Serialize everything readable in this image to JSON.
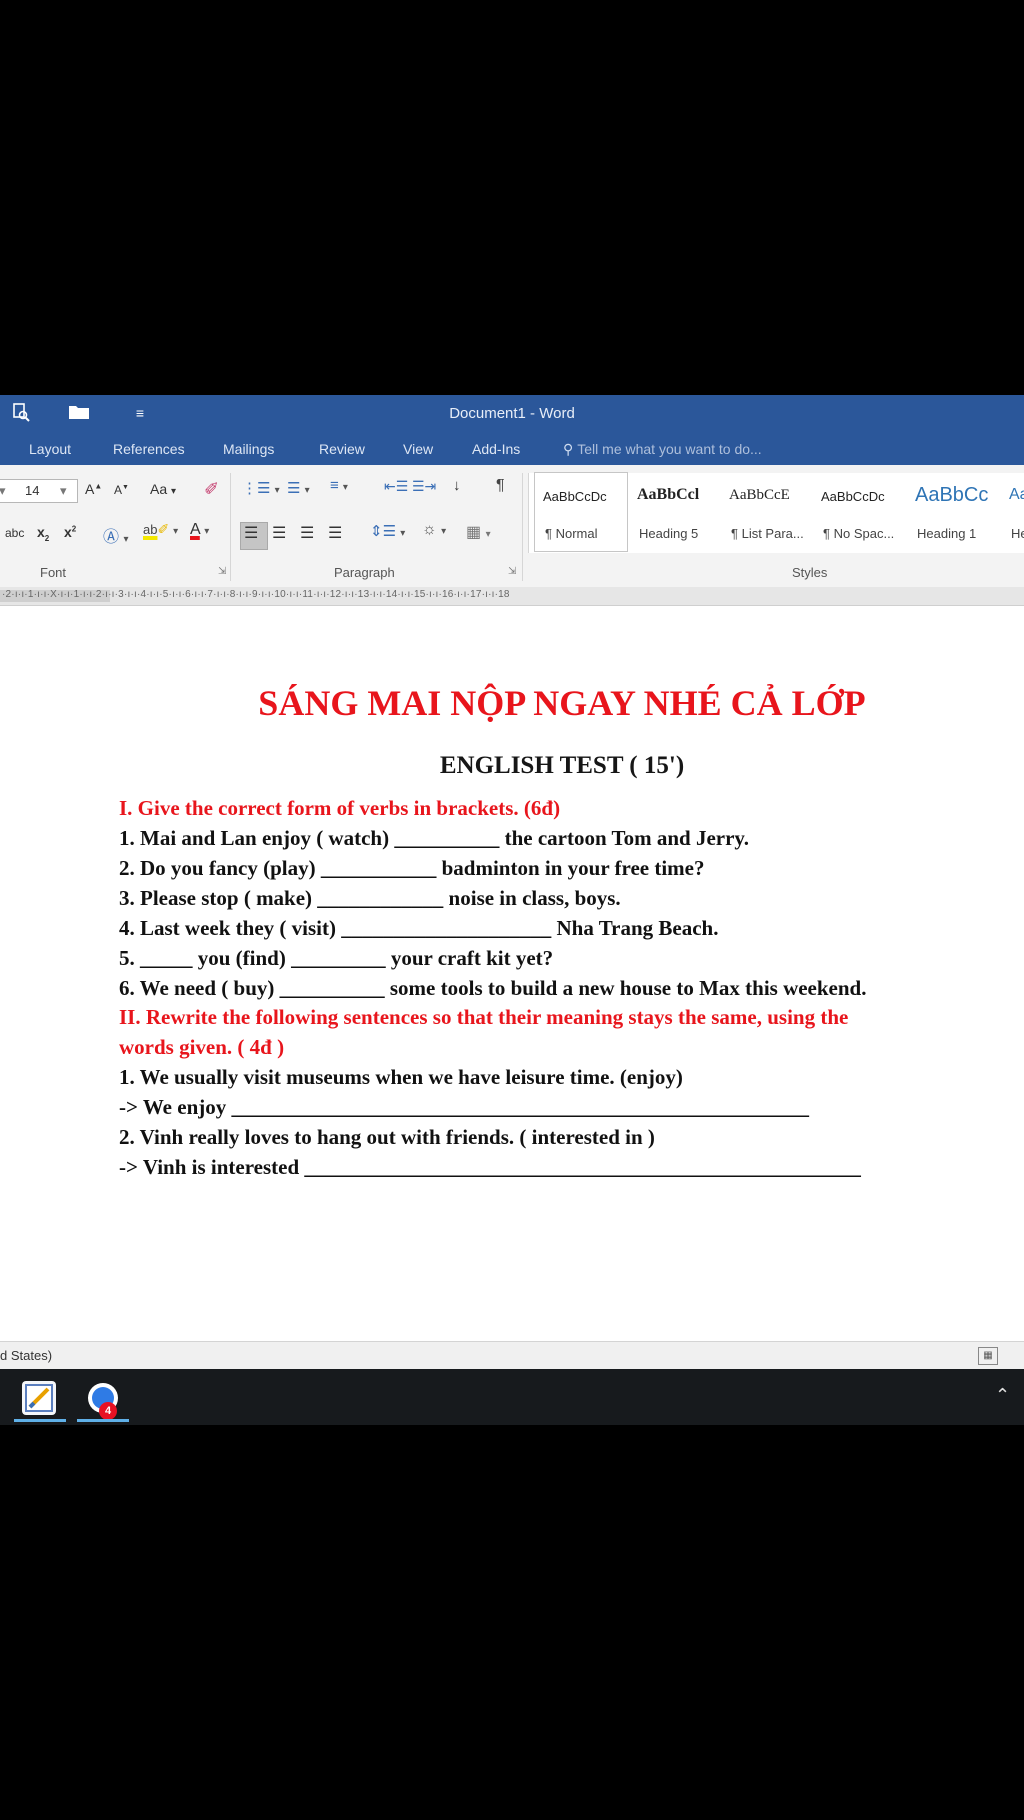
{
  "window": {
    "title": "Document1 - Word"
  },
  "ribbon_tabs": [
    "Layout",
    "References",
    "Mailings",
    "Review",
    "View",
    "Add-Ins"
  ],
  "tell_me": "Tell me what you want to do...",
  "font_group": {
    "font_size": "14",
    "grow_label": "A",
    "shrink_label": "A",
    "change_case": "Aa",
    "strikethrough": "abc",
    "subscript": "x",
    "superscript": "x",
    "group_name": "Font"
  },
  "paragraph_group": {
    "group_name": "Paragraph"
  },
  "styles_group": {
    "group_name": "Styles",
    "items": [
      {
        "preview": "AaBbCcDc",
        "name": "¶ Normal"
      },
      {
        "preview": "AaBbCcl",
        "name": "Heading 5"
      },
      {
        "preview": "AaBbCcE",
        "name": "¶ List Para..."
      },
      {
        "preview": "AaBbCcDc",
        "name": "¶ No Spac..."
      },
      {
        "preview": "AaBbCc",
        "name": "Heading 1"
      },
      {
        "preview": "Aa",
        "name": "He"
      }
    ]
  },
  "ruler_marks": "·2·ı·ı·1·ı·ı·X·ı·ı·1·ı·ı·2·ı·ı·3·ı·ı·4·ı·ı·5·ı·ı·6·ı·ı·7·ı·ı·8·ı·ı·9·ı·ı·10·ı·ı·11·ı·ı·12·ı·ı·13·ı·ı·14·ı·ı·15·ı·ı·16·ı·ı·17·ı·ı·18",
  "document": {
    "banner": "SÁNG MAI NỘP NGAY NHÉ CẢ LỚP",
    "test_title": "ENGLISH TEST ( 15')",
    "section1_heading": "I. Give the correct form of verbs in brackets. (6đ)",
    "section1_items": [
      "1. Mai and Lan enjoy ( watch) __________ the cartoon Tom and Jerry.",
      "2. Do you fancy (play) ___________ badminton in your free time?",
      "3. Please stop ( make) ____________ noise in class, boys.",
      "4. Last week they ( visit) ____________________ Nha Trang Beach.",
      "5. _____ you (find) _________ your craft kit yet?",
      "6. We need ( buy) __________ some tools to build a new house to Max this weekend."
    ],
    "section2_heading_line1": "II. Rewrite the following sentences so that their meaning stays the same, using the",
    "section2_heading_line2": "words given. ( 4đ )",
    "section2_items": [
      "1. We usually visit museums when we have leisure time. (enjoy)",
      "-> We enjoy _______________________________________________________",
      "2. Vinh really loves to hang out with friends. ( interested in )",
      "-> Vinh is interested _____________________________________________________"
    ]
  },
  "status_bar": {
    "language": "d States)"
  },
  "taskbar": {
    "badge_count": "4"
  },
  "colors": {
    "word_blue": "#2b579a",
    "heading_red": "#e8151c"
  }
}
